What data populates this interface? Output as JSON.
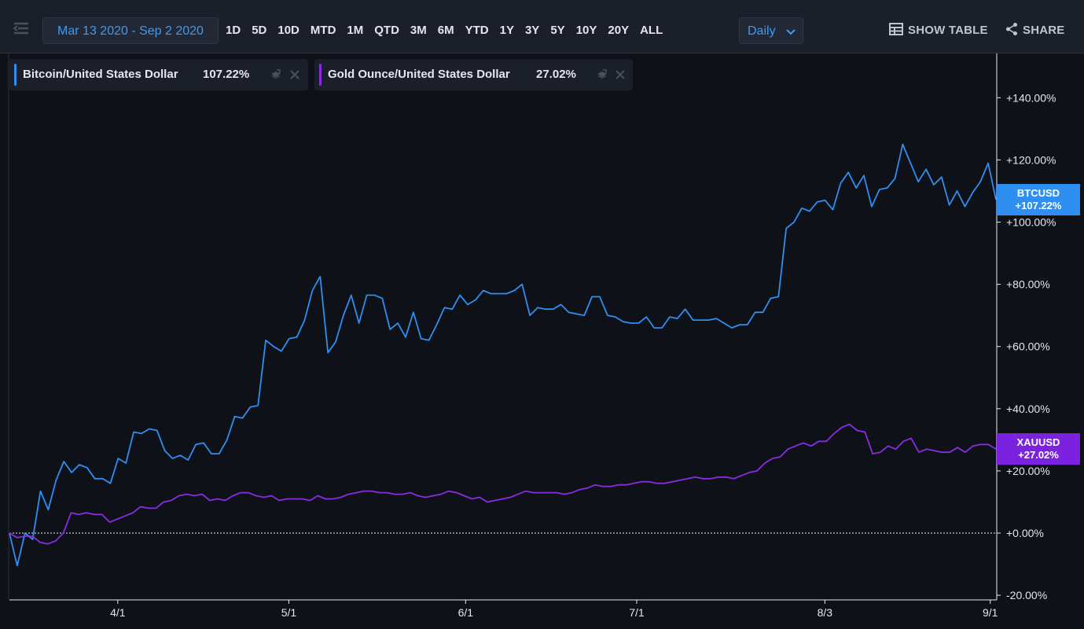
{
  "toolbar": {
    "date_range": "Mar 13 2020 - Sep 2 2020",
    "periods": [
      "1D",
      "5D",
      "10D",
      "MTD",
      "1M",
      "QTD",
      "3M",
      "6M",
      "YTD",
      "1Y",
      "3Y",
      "5Y",
      "10Y",
      "20Y",
      "ALL"
    ],
    "interval": "Daily",
    "show_table": "SHOW TABLE",
    "share": "SHARE"
  },
  "legend": [
    {
      "name": "Bitcoin/United States Dollar",
      "value": "107.22%",
      "color": "#2f8ff0"
    },
    {
      "name": "Gold Ounce/United States Dollar",
      "value": "27.02%",
      "color": "#8a2be2"
    }
  ],
  "tags": [
    {
      "ticker": "BTCUSD",
      "value": "+107.22%",
      "color": "#2f8ff0"
    },
    {
      "ticker": "XAUUSD",
      "value": "+27.02%",
      "color": "#7b22e0"
    }
  ],
  "chart_data": {
    "type": "line",
    "x_tick_labels": [
      "4/1",
      "5/1",
      "6/1",
      "7/1",
      "8/3",
      "9/1"
    ],
    "y_tick_labels": [
      "+140.00%",
      "+120.00%",
      "+100.00%",
      "+80.00%",
      "+60.00%",
      "+40.00%",
      "+20.00%",
      "+0.00%",
      "-20.00%"
    ],
    "ylim": [
      -20,
      150
    ],
    "x_dates": [
      "2020-03-13",
      "2020-04-01",
      "2020-05-01",
      "2020-06-01",
      "2020-07-01",
      "2020-08-03",
      "2020-09-01",
      "2020-09-02"
    ],
    "series": [
      {
        "name": "Bitcoin/United States Dollar",
        "color": "#2f8ff0",
        "values": [
          0,
          -10.5,
          0,
          -2,
          13.5,
          7.5,
          17,
          23,
          19.5,
          22,
          21,
          17.5,
          17.5,
          16,
          24,
          22.5,
          32.5,
          32,
          33.5,
          33,
          26.5,
          24,
          25,
          23.5,
          28.5,
          29,
          25.5,
          25.5,
          30,
          37.5,
          37,
          40.5,
          41,
          62,
          60,
          58.5,
          62.5,
          63,
          68.5,
          78,
          82.5,
          58,
          61.5,
          70,
          76.5,
          67.5,
          76.5,
          76.5,
          75.5,
          65.5,
          67.5,
          63,
          71,
          62.5,
          62,
          67,
          72.5,
          72,
          76.5,
          73.5,
          75,
          78,
          77,
          77,
          77,
          78,
          80,
          70,
          72.5,
          72,
          72,
          73.5,
          71,
          70.5,
          70,
          76,
          76,
          70,
          69.5,
          68,
          67.5,
          67.5,
          69.5,
          66,
          66,
          69.5,
          69,
          72,
          68.5,
          68.5,
          68.5,
          69,
          67.5,
          66,
          67,
          67,
          71,
          71,
          75.5,
          76,
          98,
          100,
          104.5,
          103.5,
          106.5,
          107,
          104,
          112.5,
          116,
          111,
          115,
          105,
          110.5,
          111,
          114,
          125,
          119,
          113,
          117,
          112,
          114.5,
          105.5,
          110,
          105,
          109.5,
          113,
          119,
          107.22
        ]
      },
      {
        "name": "Gold Ounce/United States Dollar",
        "color": "#8a2be2",
        "values": [
          0,
          -1.5,
          -1,
          -1,
          -3,
          -3.5,
          -2.5,
          0,
          6.5,
          6,
          6.5,
          6,
          6,
          3.5,
          4.5,
          5.5,
          6.5,
          8.5,
          8,
          8,
          10,
          10.5,
          12,
          12.5,
          12,
          12.5,
          10.5,
          11,
          10.5,
          12,
          13,
          13,
          12,
          11.5,
          12,
          10.5,
          11,
          11,
          11,
          10.5,
          12,
          11,
          11,
          11.5,
          12.5,
          13,
          13.5,
          13.5,
          13,
          13,
          12.5,
          12.5,
          13,
          12,
          11.5,
          12,
          12.5,
          13.5,
          13,
          12,
          11,
          11.5,
          10,
          10.5,
          11,
          11.5,
          12.5,
          13.5,
          13,
          13,
          13,
          13,
          12.5,
          13,
          14,
          14.5,
          15.5,
          15,
          15,
          15.5,
          15.5,
          16,
          16.5,
          16.5,
          16,
          16,
          16.5,
          17,
          17.5,
          18,
          17.5,
          17.5,
          18,
          18,
          17.5,
          18.5,
          19.5,
          20,
          22.5,
          24,
          24.5,
          27,
          28,
          29,
          28,
          29.5,
          29.5,
          32,
          34,
          35,
          33,
          32.5,
          25.5,
          26,
          28,
          27,
          29.5,
          30.5,
          26,
          27,
          26.5,
          26,
          26,
          27.5,
          26,
          28,
          28.5,
          28.5,
          27.02
        ]
      }
    ]
  }
}
